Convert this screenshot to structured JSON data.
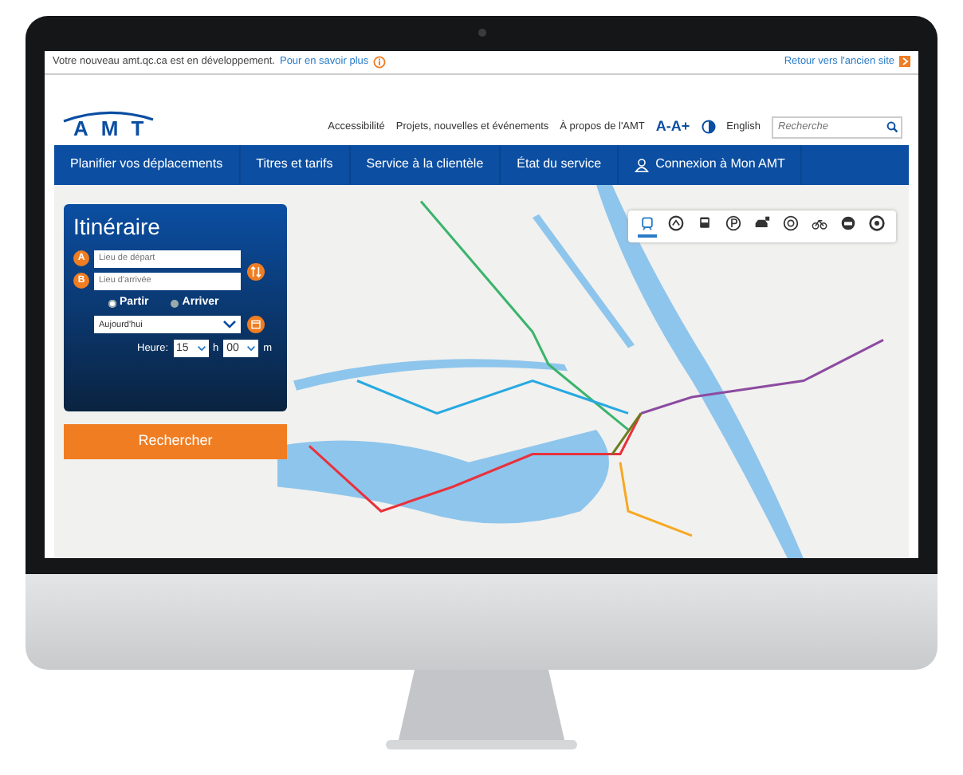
{
  "banner": {
    "text": "Votre nouveau amt.qc.ca est en développement.",
    "link": "Pour en savoir plus",
    "right_link": "Retour vers l'ancien site"
  },
  "header": {
    "logo": "AMT",
    "links": [
      "Accessibilité",
      "Projets, nouvelles et événements",
      "À propos de l'AMT"
    ],
    "font_size_control": "A-A+",
    "language": "English",
    "search": {
      "placeholder": "Recherche"
    }
  },
  "nav": [
    {
      "label": "Planifier vos déplacements",
      "kind": "plain"
    },
    {
      "label": "Titres et tarifs",
      "kind": "plain"
    },
    {
      "label": "Service à la clientèle",
      "kind": "plain"
    },
    {
      "label": "État du service",
      "kind": "plain"
    },
    {
      "label": "Connexion à Mon AMT",
      "kind": "account"
    }
  ],
  "itinerary": {
    "title": "Itinéraire",
    "fields": [
      {
        "marker": "A",
        "placeholder": "Lieu de départ"
      },
      {
        "marker": "B",
        "placeholder": "Lieu d'arrivée"
      }
    ],
    "modes": [
      {
        "label": "Partir",
        "selected": true
      },
      {
        "label": "Arriver",
        "selected": false
      }
    ],
    "day": "Aujourd'hui",
    "time_label": "Heure:",
    "hour": "15",
    "hour_unit": "h",
    "minute": "00",
    "minute_unit": "m",
    "search_button": "Rechercher"
  },
  "transport_filters": [
    {
      "kind": "train",
      "selected": true
    },
    {
      "kind": "metro",
      "selected": false
    },
    {
      "kind": "bus",
      "selected": false
    },
    {
      "kind": "parking",
      "selected": false
    },
    {
      "kind": "car",
      "selected": false
    },
    {
      "kind": "ring",
      "selected": false
    },
    {
      "kind": "bike",
      "selected": false
    },
    {
      "kind": "taxi",
      "selected": false
    },
    {
      "kind": "more",
      "selected": false
    }
  ]
}
